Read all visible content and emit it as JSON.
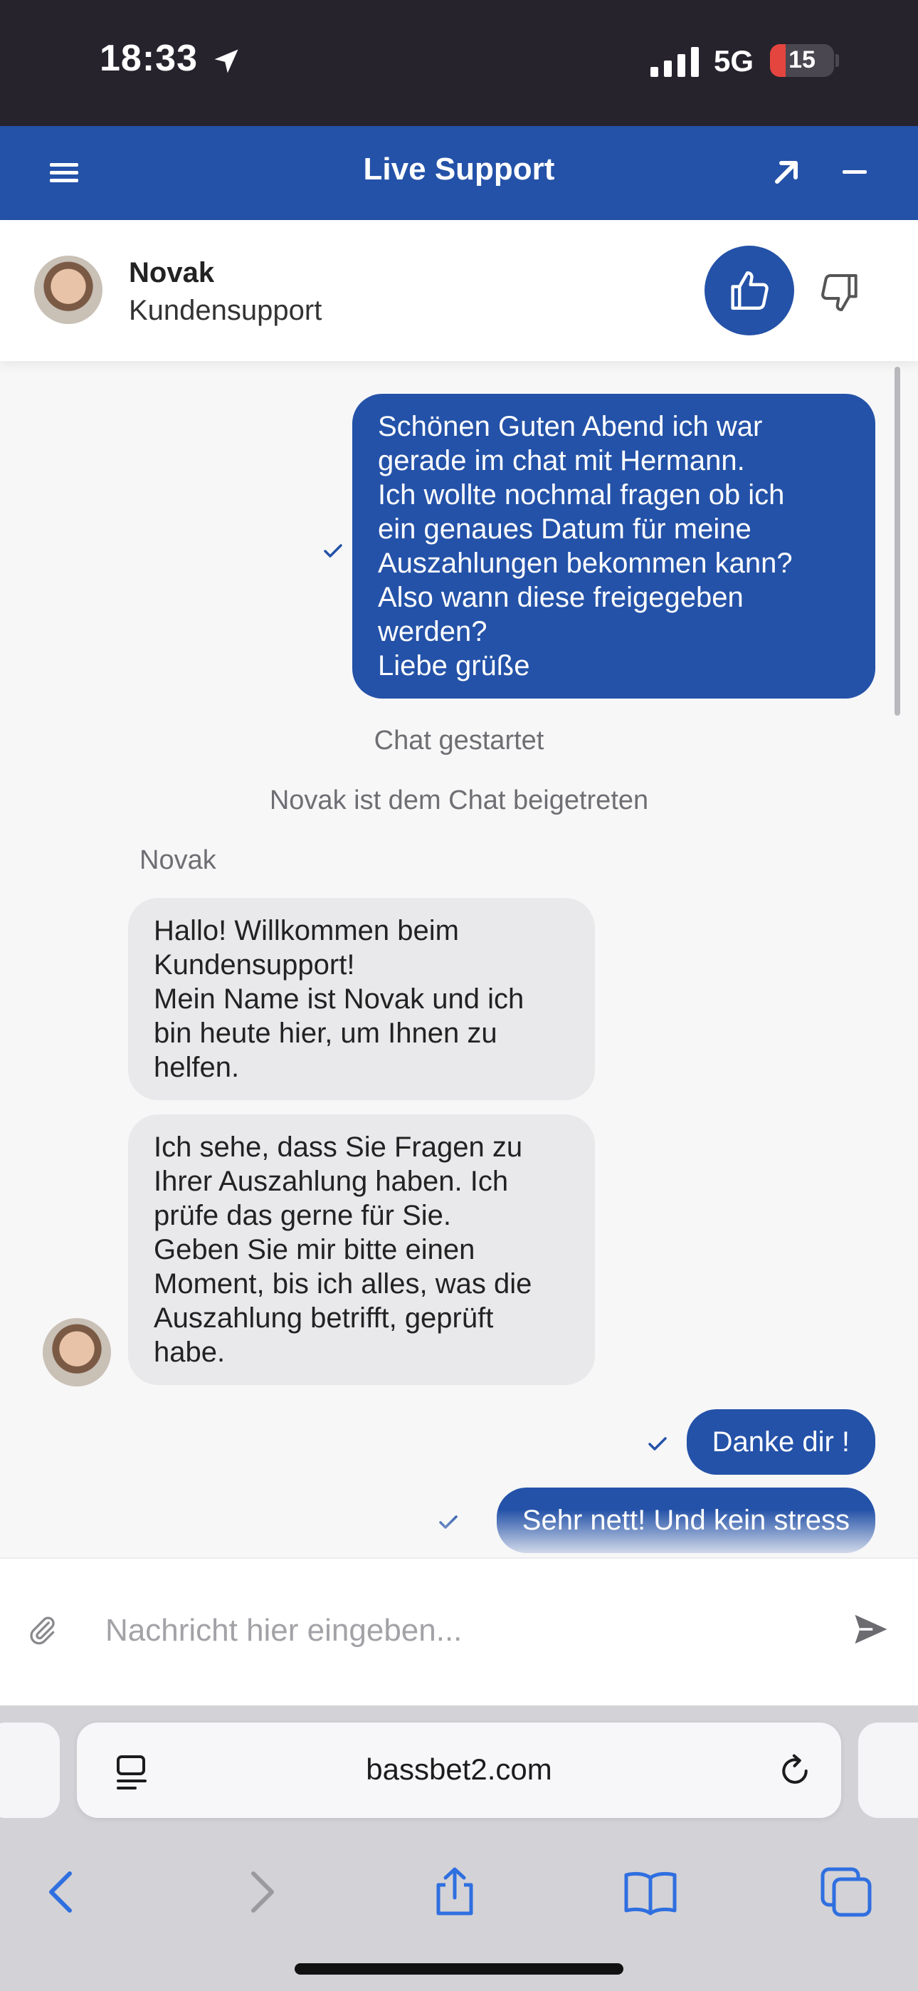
{
  "status_bar": {
    "time": "18:33",
    "network": "5G",
    "battery": "15",
    "icons": [
      "location-arrow-icon",
      "signal-icon",
      "battery-icon"
    ]
  },
  "header": {
    "title": "Live Support",
    "icons": [
      "menu-icon",
      "expand-icon",
      "minimize-icon"
    ],
    "color": "#2452a8"
  },
  "agent": {
    "name": "Novak",
    "role": "Kundensupport",
    "icons": [
      "thumbs-up-icon",
      "thumbs-down-icon"
    ]
  },
  "messages": [
    {
      "direction": "out",
      "text": "Schönen Guten Abend ich war\ngerade im chat mit Hermann.\nIch wollte nochmal fragen ob ich\nein genaues Datum für meine\nAuszahlungen bekommen kann?\nAlso wann diese freigegeben\nwerden?\nLiebe grüße"
    },
    {
      "direction": "system",
      "text": "Chat gestartet"
    },
    {
      "direction": "system",
      "text": "Novak ist dem Chat beigetreten"
    },
    {
      "direction": "sender",
      "text": "Novak"
    },
    {
      "direction": "in",
      "text": "Hallo! Willkommen beim\nKundensupport!\nMein Name ist Novak und ich\nbin heute hier, um Ihnen zu\nhelfen."
    },
    {
      "direction": "in",
      "text": "Ich sehe, dass Sie Fragen zu\nIhrer Auszahlung haben. Ich\nprüfe das gerne für Sie.\nGeben Sie mir bitte einen\nMoment, bis ich alles, was die\nAuszahlung betrifft, geprüft\nhabe."
    },
    {
      "direction": "out",
      "text": "Danke dir !"
    },
    {
      "direction": "out",
      "text": "Sehr nett! Und kein stress"
    }
  ],
  "input": {
    "placeholder": "Nachricht hier eingeben...",
    "value": "",
    "icons": [
      "paperclip-icon",
      "send-icon"
    ]
  },
  "browser": {
    "url": "bassbet2.com",
    "icons": [
      "reader-icon",
      "reload-icon",
      "back-icon",
      "forward-icon",
      "share-icon",
      "bookmarks-icon",
      "tabs-icon"
    ]
  }
}
